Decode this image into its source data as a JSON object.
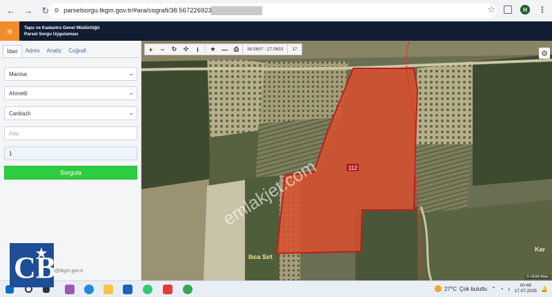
{
  "browser": {
    "url": "parselsorgu.tkgm.gov.tr/#ara/cografi/38.56722692309436/27.",
    "profile_initial": "H"
  },
  "app": {
    "title_line1": "Tapu ve Kadastro Genel Müdürlüğü",
    "title_line2": "Parsel Sorgu Uygulaması"
  },
  "sidebar": {
    "tabs": [
      {
        "label": "İdari",
        "active": true
      },
      {
        "label": "Adres",
        "active": false
      },
      {
        "label": "Analiz",
        "active": false
      },
      {
        "label": "Coğrafi",
        "active": false
      }
    ],
    "province": "Manisa",
    "district": "Ahmetli",
    "neighborhood": "Canbazlı",
    "ada_placeholder": "Ada",
    "parsel_value": "1",
    "query_button": "Sorgula",
    "contact": "bs@tkgm.gov.tr"
  },
  "map": {
    "coordinates": "38.5697 : 27.0833",
    "zoom": "17",
    "parcel_label": "112",
    "place_label": "Ilıca Sırt",
    "place_label_right": "Kar",
    "attribution": "© HGM Atlas",
    "watermark": "emlakjet.com",
    "parcel_color": "#d9502e",
    "parcel_border": "#b81e1e"
  },
  "toolbar_icons": [
    "zoom-in",
    "zoom-out",
    "refresh",
    "move",
    "info",
    "bookmark",
    "measure",
    "print"
  ],
  "taskbar": {
    "temperature": "27°C",
    "weather": "Çok bulutlu",
    "time": "00:49",
    "date": "17.07.2025"
  },
  "logo_text": "CB"
}
